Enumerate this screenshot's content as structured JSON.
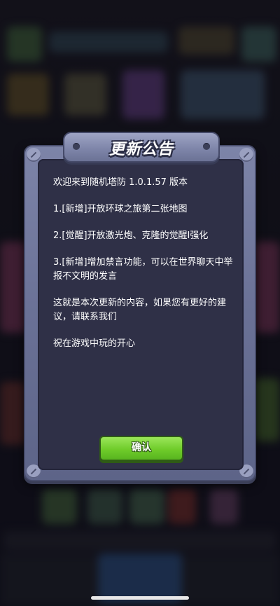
{
  "dialog": {
    "title": "更新公告",
    "lines": [
      "欢迎来到随机塔防 1.0.1.57 版本",
      "1.[新增]开放环球之旅第二张地图",
      "2.[觉醒]开放激光炮、克隆的觉醒Ⅰ强化",
      "3.[新增]增加禁言功能，可以在世界聊天中举报不文明的发言",
      "这就是本次更新的内容，如果您有更好的建议，请联系我们",
      "祝在游戏中玩的开心"
    ],
    "confirm_label": "确认"
  },
  "colors": {
    "dialog_frame": "#6a7196",
    "dialog_inner": "#2f3047",
    "confirm_button": "#6fcc2a"
  },
  "icons": [
    "bolt-icon",
    "corner-rivet-icon"
  ]
}
